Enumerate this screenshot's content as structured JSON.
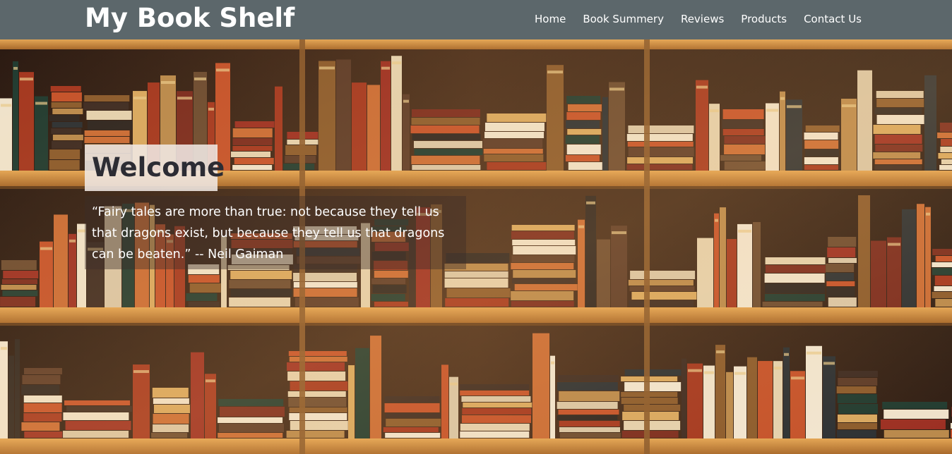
{
  "header": {
    "brand": "My Book Shelf",
    "nav": [
      "Home",
      "Book Summery",
      "Reviews",
      "Products",
      "Contact Us"
    ]
  },
  "hero": {
    "welcome": "Welcome",
    "quote": "“Fairy tales are more than true: not because they tell us that dragons exist, but because they tell us that dragons can be beaten.” -- Neil Gaiman",
    "background": "bookshelf-photo"
  },
  "colors": {
    "navbar": "#5c676b",
    "shelf_wood": "#c98a3e",
    "shelf_back": "#3b2314"
  }
}
